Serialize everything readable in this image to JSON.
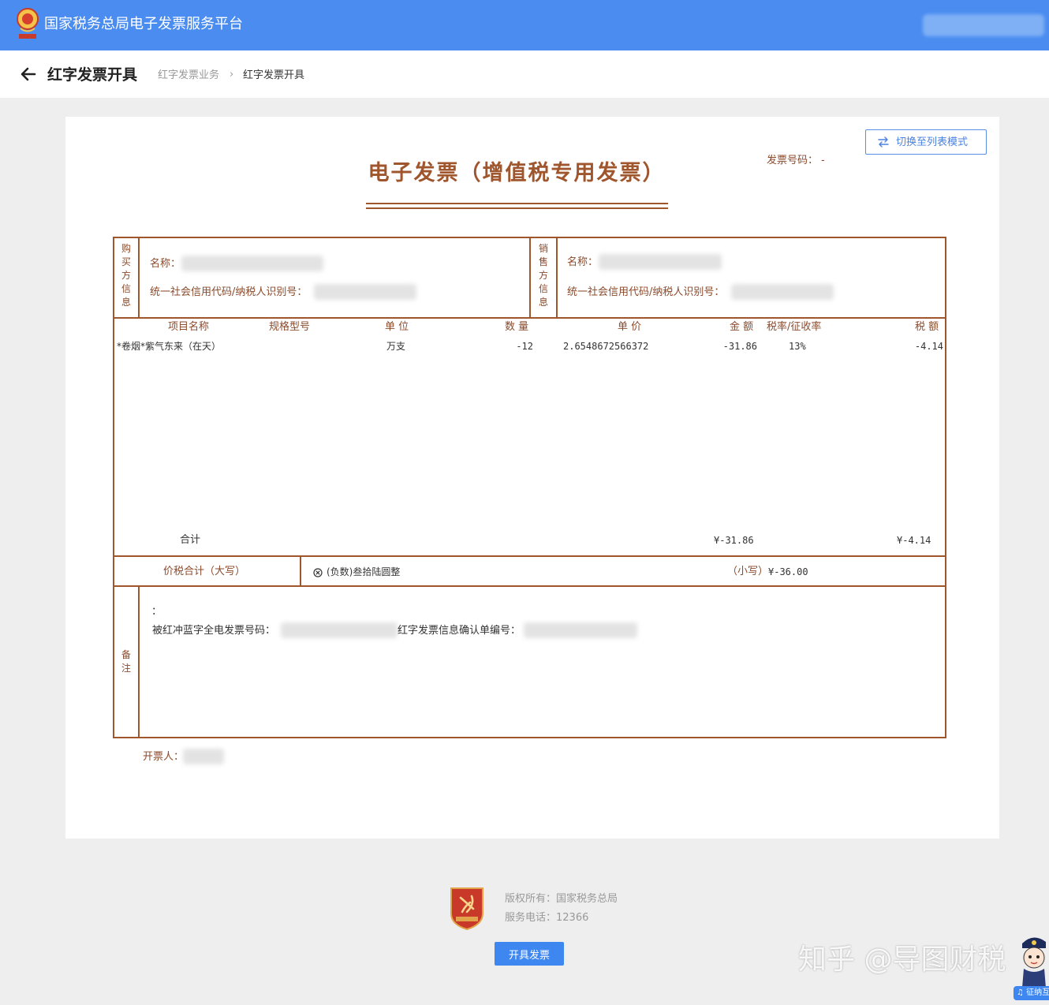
{
  "app": {
    "title": "国家税务总局电子发票服务平台",
    "emblem_icon": "tax-emblem-icon"
  },
  "subheader": {
    "title": "红字发票开具",
    "back_icon": "arrow-left-icon",
    "breadcrumb": [
      "红字发票业务",
      "红字发票开具"
    ],
    "breadcrumb_sep": "›"
  },
  "toolbar": {
    "switch_label": "切换至列表模式",
    "switch_icon": "swap-arrows-icon"
  },
  "invoice": {
    "title": "电子发票（增值税专用发票）",
    "number_label": "发票号码：",
    "number_value": "-",
    "buyer": {
      "side_label": [
        "购",
        "买",
        "方",
        "信",
        "息"
      ],
      "name_label": "名称：",
      "tax_id_label": "统一社会信用代码/纳税人识别号："
    },
    "seller": {
      "side_label": [
        "销",
        "售",
        "方",
        "信",
        "息"
      ],
      "name_label": "名称：",
      "tax_id_label": "统一社会信用代码/纳税人识别号："
    },
    "columns": {
      "item_name": "项目名称",
      "spec": "规格型号",
      "unit": "单 位",
      "qty": "数 量",
      "price": "单 价",
      "amount": "金 额",
      "rate": "税率/征收率",
      "tax": "税 额"
    },
    "items": [
      {
        "name": "*卷烟*紫气东来（在天）",
        "unit": "万支",
        "qty": "-12",
        "price": "2.6548672566372",
        "amount": "-31.86",
        "rate": "13%",
        "tax": "-4.14"
      }
    ],
    "subtotal": {
      "label": "合计",
      "amount": "¥-31.86",
      "tax": "¥-4.14"
    },
    "grand_total": {
      "label": "价税合计（大写）",
      "negative_icon": "circle-x-icon",
      "upper": "(负数)叁拾陆圆整",
      "lower_label": "（小写）",
      "lower": "¥-36.00"
    },
    "remarks": {
      "side_label": [
        "备",
        "注"
      ],
      "colon": "：",
      "blue_no_label": "被红冲蓝字全电发票号码：",
      "confirm_no_label": "红字发票信息确认单编号："
    },
    "drawer_label": "开票人："
  },
  "footer": {
    "logo_icon": "party-badge-icon",
    "copyright": "版权所有：国家税务总局",
    "phone": "服务电话：12366",
    "issue_button": "开具发票"
  },
  "overlay": {
    "watermark": "知乎 @导图财税",
    "mascot_icon": "tax-officer-mascot-icon",
    "service_label": "征纳互动"
  }
}
